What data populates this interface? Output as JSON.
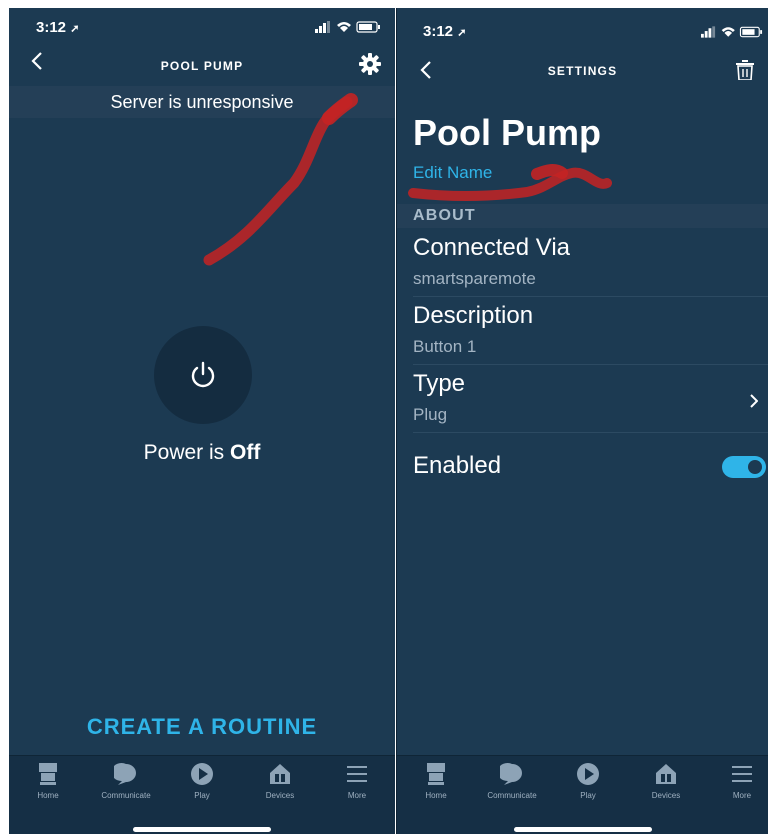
{
  "left": {
    "status": {
      "time": "3:12"
    },
    "nav": {
      "title": "POOL PUMP"
    },
    "banner": "Server is unresponsive",
    "power": {
      "prefix": "Power is",
      "state": "Off"
    },
    "routine_label": "CREATE A ROUTINE"
  },
  "right": {
    "status": {
      "time": "3:12"
    },
    "nav": {
      "title": "SETTINGS"
    },
    "device_name": "Pool Pump",
    "edit_name": "Edit Name",
    "section_about": "ABOUT",
    "rows": [
      {
        "title": "Connected Via",
        "value": "smartsparemote"
      },
      {
        "title": "Description",
        "value": "Button 1"
      },
      {
        "title": "Type",
        "value": "Plug"
      }
    ],
    "enabled_label": "Enabled",
    "enabled": true
  },
  "tabs": [
    {
      "label": "Home",
      "icon": "home-icon"
    },
    {
      "label": "Communicate",
      "icon": "chat-bubble-icon"
    },
    {
      "label": "Play",
      "icon": "play-icon"
    },
    {
      "label": "Devices",
      "icon": "devices-icon"
    },
    {
      "label": "More",
      "icon": "menu-icon"
    }
  ],
  "colors": {
    "background": "#1c3a52",
    "accent": "#2fb4e8",
    "annotation": "#c42323"
  }
}
